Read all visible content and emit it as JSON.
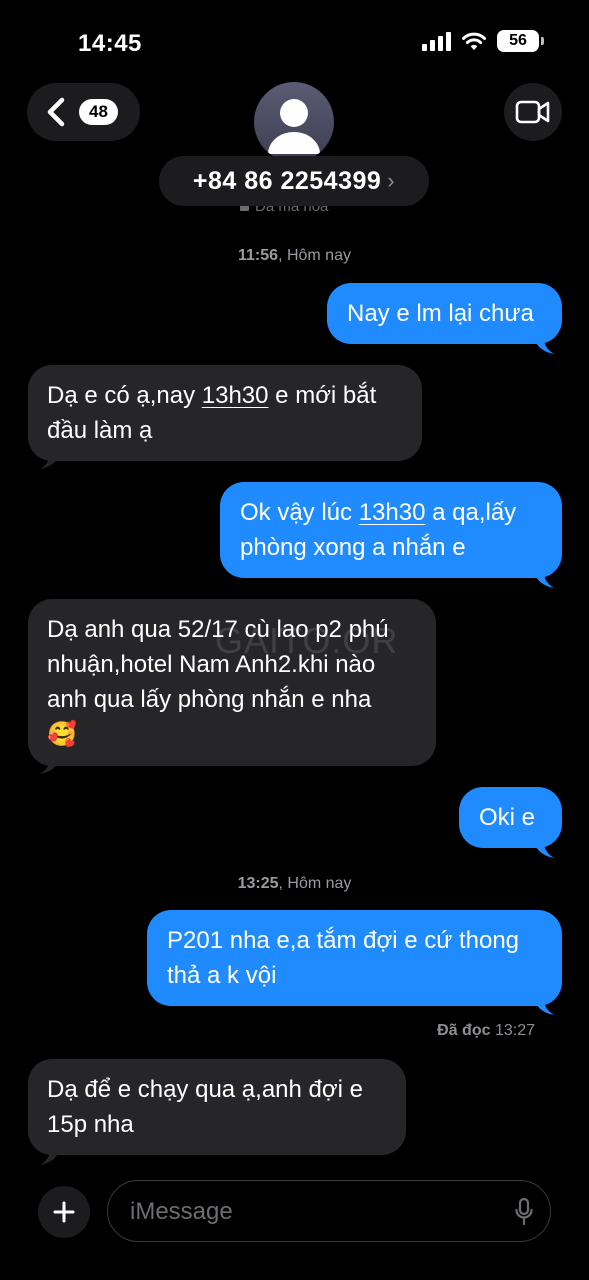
{
  "status": {
    "time": "14:45",
    "battery": "56"
  },
  "nav": {
    "back_badge": "48"
  },
  "contact": {
    "number": "+84 86 2254399",
    "chevron": "›",
    "encryption_text": "Đã mã hóa"
  },
  "watermark": "GAITO.OR",
  "timestamps": [
    {
      "time": "11:56",
      "label": ", Hôm nay"
    },
    {
      "time": "13:25",
      "label": ", Hôm nay"
    }
  ],
  "messages": [
    {
      "direction": "out",
      "lines": [
        "Nay e lm lại chưa"
      ]
    },
    {
      "direction": "in",
      "parts": [
        "Dạ e có ạ,nay ",
        "13h30",
        " e mới bắt",
        "đầu làm ạ"
      ]
    },
    {
      "direction": "out",
      "parts": [
        "Ok vậy lúc ",
        "13h30",
        " a qa,lấy",
        "phòng xong a nhắn e"
      ]
    },
    {
      "direction": "in",
      "lines": [
        "Dạ anh qua 52/17 cù lao p2 phú",
        "nhuận,hotel Nam Anh2.khi nào",
        "anh qua lấy phòng nhắn e nha",
        "🥰"
      ]
    },
    {
      "direction": "out",
      "lines": [
        "Oki e"
      ]
    },
    {
      "direction": "out",
      "lines": [
        "P201 nha e,a tắm đợi e cứ thong",
        "thả a k vội"
      ]
    },
    {
      "direction": "in",
      "lines": [
        "Dạ để e chạy qua ạ,anh đợi e",
        "15p nha"
      ]
    }
  ],
  "read_receipt": {
    "label": "Đã đọc",
    "time": "13:27"
  },
  "composer": {
    "placeholder": "iMessage"
  },
  "colors": {
    "outgoing": "#1f8bfe",
    "incoming": "#262628",
    "background": "#000000"
  },
  "icons": [
    "chevron-left-icon",
    "video-camera-icon",
    "person-icon",
    "lock-icon",
    "plus-icon",
    "microphone-icon",
    "signal-icon",
    "wifi-icon",
    "battery-icon"
  ]
}
